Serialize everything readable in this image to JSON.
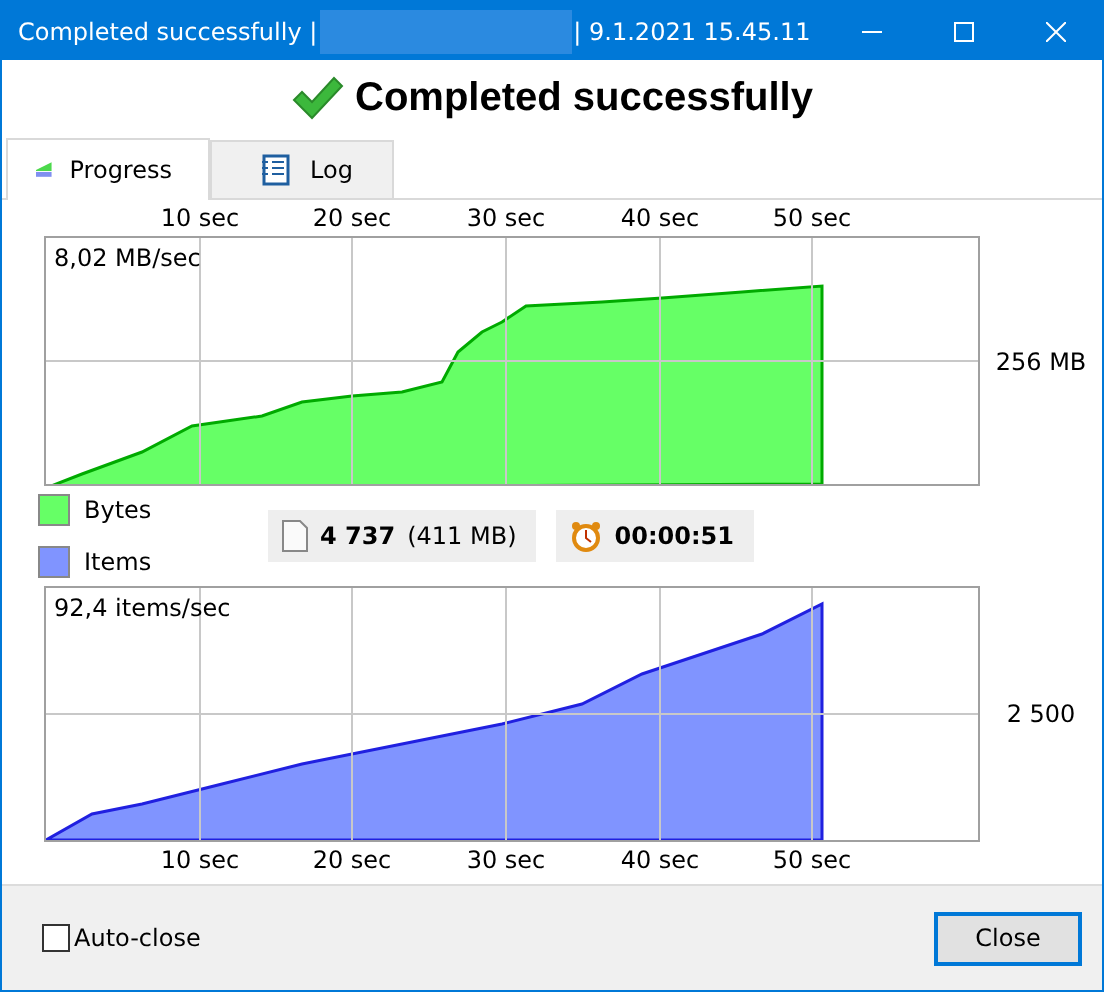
{
  "window": {
    "title_prefix": "Completed successfully |",
    "title_suffix": "| 9.1.2021 15.45.11"
  },
  "heading": "Completed successfully",
  "tabs": [
    {
      "label": "Progress",
      "selected": true,
      "kind": "progress"
    },
    {
      "label": "Log",
      "selected": false,
      "kind": "log"
    }
  ],
  "charts": [
    {
      "rate": "8,02 MB/sec",
      "scale": "256 MB",
      "ticks_top": [
        "10 sec",
        "20 sec",
        "30 sec",
        "40 sec",
        "50 sec"
      ]
    },
    {
      "rate": "92,4 items/sec",
      "scale": "2 500",
      "ticks_bottom": [
        "10 sec",
        "20 sec",
        "30 sec",
        "40 sec",
        "50 sec"
      ]
    }
  ],
  "legend": [
    {
      "label": "Bytes",
      "color": "#66ff66"
    },
    {
      "label": "Items",
      "color": "#8094ff"
    }
  ],
  "stats": [
    {
      "kind": "file",
      "value": "4 737",
      "detail": "(411 MB)"
    },
    {
      "kind": "clock",
      "value": "00:00:51"
    }
  ],
  "auto_close": {
    "label": "Auto-close",
    "checked": false
  },
  "close_button": "Close"
}
